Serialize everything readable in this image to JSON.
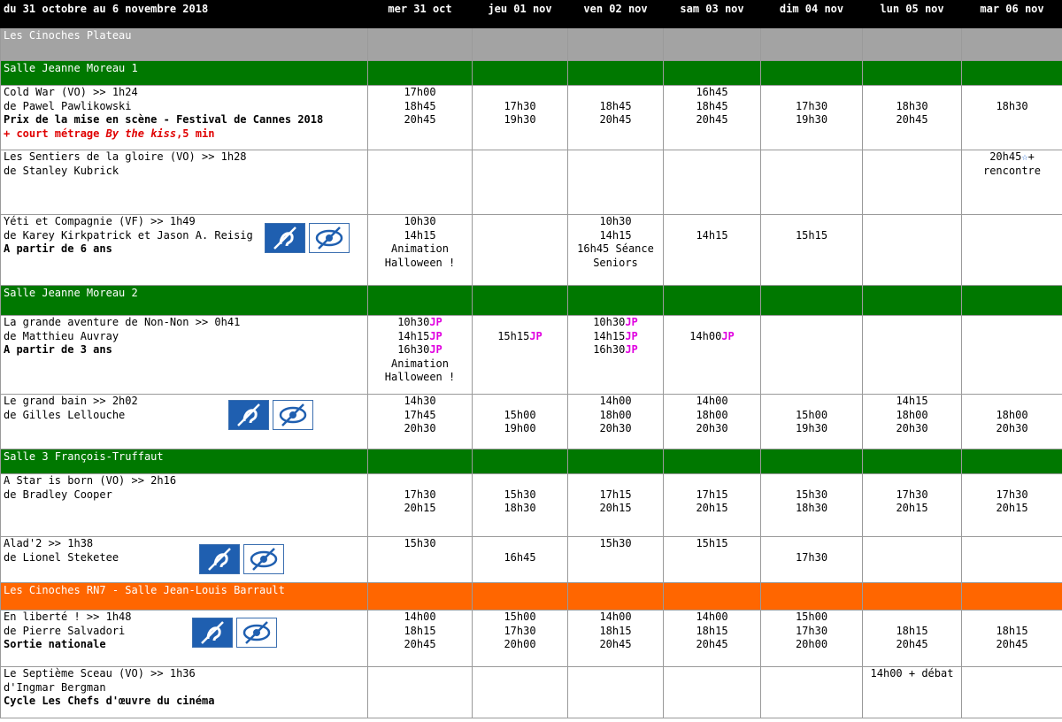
{
  "header": {
    "period": "du 31 octobre au 6 novembre 2018",
    "days": [
      "mer 31 oct",
      "jeu 01 nov",
      "ven 02 nov",
      "sam 03 nov",
      "dim 04 nov",
      "lun 05 nov",
      "mar 06 nov"
    ]
  },
  "sections": {
    "plateau": "Les Cinoches Plateau",
    "jm1": "Salle Jeanne Moreau 1",
    "jm2": "Salle Jeanne Moreau 2",
    "ft3": "Salle 3 François-Truffaut",
    "rn7": "Les Cinoches RN7 - Salle Jean-Louis Barrault"
  },
  "colors": {
    "header": "#000000",
    "plateau": "#a3a3a3",
    "salle": "#007800",
    "rn7": "#ff6600",
    "jp": "#e000e0",
    "note": "#e00000"
  },
  "icons": [
    "hearing-impaired-icon",
    "visually-impaired-icon"
  ],
  "jp_tag": "JP",
  "films": {
    "coldwar": {
      "title": "Cold War (VO) >> 1h24",
      "director": "de Pawel Pawlikowski",
      "note": "Prix de la mise en scène - Festival de Cannes 2018",
      "extra_prefix": "+ court métrage ",
      "extra_italic": "By the kiss",
      "extra_suffix": ",5 min",
      "times": [
        [
          "17h00",
          "18h45",
          "20h45"
        ],
        [
          "",
          "17h30",
          "19h30"
        ],
        [
          "",
          "18h45",
          "20h45"
        ],
        [
          "16h45",
          "18h45",
          "20h45"
        ],
        [
          "",
          "17h30",
          "19h30"
        ],
        [
          "",
          "18h30",
          "20h45"
        ],
        [
          "",
          "18h30"
        ]
      ]
    },
    "sentiers": {
      "title": "Les Sentiers de la gloire (VO) >> 1h28",
      "director": "de Stanley Kubrick",
      "special_time": "20h45",
      "special_suffix": "+",
      "special_note": "rencontre"
    },
    "yeti": {
      "title": "Yéti et Compagnie (VF) >> 1h49",
      "director": "de Karey Kirkpatrick et Jason A. Reisig",
      "note": "A partir de 6 ans",
      "times": [
        [
          "10h30",
          "14h15",
          "Animation",
          "Halloween !"
        ],
        [],
        [
          "10h30",
          "14h15",
          "16h45 Séance",
          "Seniors"
        ],
        [
          "",
          "14h15"
        ],
        [
          "",
          "15h15"
        ],
        [],
        []
      ]
    },
    "nonnon": {
      "title": "La grande aventure de Non-Non >> 0h41",
      "director": "de Matthieu Auvray",
      "note": "A partir de 3 ans",
      "wed": [
        "10h30",
        "14h15",
        "16h30"
      ],
      "wed_extra": [
        "Animation",
        "Halloween !"
      ],
      "thu": "15h15",
      "fri": [
        "10h30",
        "14h15",
        "16h30"
      ],
      "sat": "14h00"
    },
    "grandbain": {
      "title": "Le grand bain >> 2h02",
      "director": "de Gilles Lellouche",
      "times": [
        [
          "14h30",
          "17h45",
          "20h30"
        ],
        [
          "",
          "15h00",
          "19h00"
        ],
        [
          "14h00",
          "18h00",
          "20h30"
        ],
        [
          "14h00",
          "18h00",
          "20h30"
        ],
        [
          "",
          "15h00",
          "19h30"
        ],
        [
          "14h15",
          "18h00",
          "20h30"
        ],
        [
          "",
          "18h00",
          "20h30"
        ]
      ]
    },
    "star": {
      "title": "A Star is born (VO) >> 2h16",
      "director": "de Bradley Cooper",
      "times": [
        [
          "",
          "17h30",
          "20h15"
        ],
        [
          "",
          "15h30",
          "18h30"
        ],
        [
          "",
          "17h15",
          "20h15"
        ],
        [
          "",
          "17h15",
          "20h15"
        ],
        [
          "",
          "15h30",
          "18h30"
        ],
        [
          "",
          "17h30",
          "20h15"
        ],
        [
          "",
          "17h30",
          "20h15"
        ]
      ]
    },
    "alad": {
      "title": "Alad'2 >> 1h38",
      "director": "de Lionel Steketee",
      "times": [
        [
          "15h30"
        ],
        [
          "",
          "16h45"
        ],
        [
          "15h30"
        ],
        [
          "15h15"
        ],
        [
          "",
          "17h30"
        ],
        [],
        []
      ]
    },
    "liberte": {
      "title": "En liberté !  >> 1h48",
      "director": "de Pierre Salvadori",
      "note": "Sortie nationale",
      "times": [
        [
          "14h00",
          "18h15",
          "20h45"
        ],
        [
          "15h00",
          "17h30",
          "20h00"
        ],
        [
          "14h00",
          "18h15",
          "20h45"
        ],
        [
          "14h00",
          "18h15",
          "20h45"
        ],
        [
          "15h00",
          "17h30",
          "20h00"
        ],
        [
          "",
          "18h15",
          "20h45"
        ],
        [
          "",
          "18h15",
          "20h45"
        ]
      ]
    },
    "sceau": {
      "title": "Le Septième Sceau (VO) >> 1h36",
      "director": "d'Ingmar Bergman",
      "note": "Cycle Les Chefs d'œuvre du cinéma",
      "mon": "14h00 + débat"
    }
  }
}
